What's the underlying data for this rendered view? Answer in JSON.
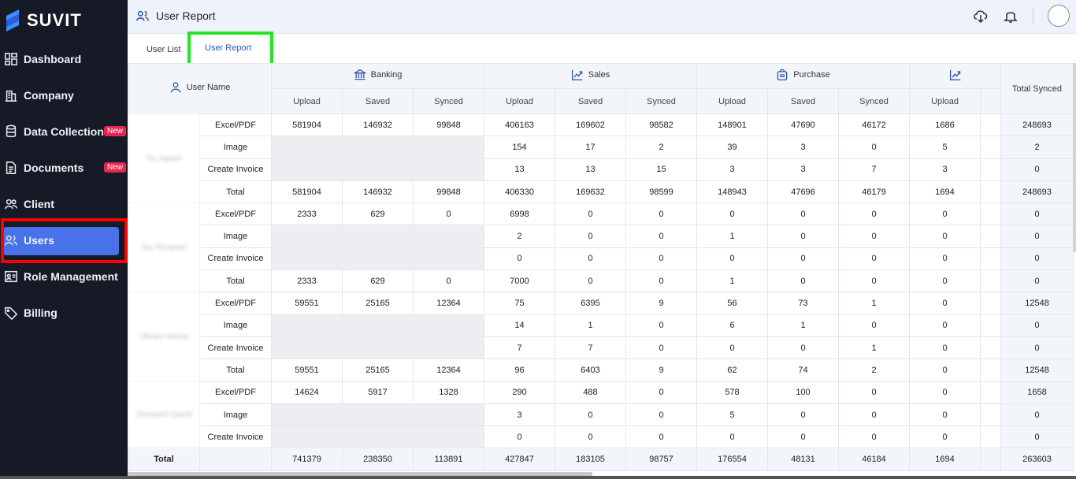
{
  "brand": {
    "name": "SUVIT"
  },
  "sidebar": {
    "items": [
      {
        "label": "Dashboard",
        "icon": "dashboard-icon"
      },
      {
        "label": "Company",
        "icon": "building-icon"
      },
      {
        "label": "Data Collection",
        "icon": "database-icon",
        "badge": "New"
      },
      {
        "label": "Documents",
        "icon": "document-icon",
        "badge": "New"
      },
      {
        "label": "Client",
        "icon": "client-icon"
      },
      {
        "label": "Users",
        "icon": "users-icon",
        "active": true
      },
      {
        "label": "Role Management",
        "icon": "role-icon"
      },
      {
        "label": "Billing",
        "icon": "tag-icon"
      }
    ]
  },
  "header": {
    "title": "User Report"
  },
  "tabs": {
    "user_list": "User List",
    "user_report": "User Report"
  },
  "table": {
    "user_name_header": "User Name",
    "groups": {
      "banking": "Banking",
      "sales": "Sales",
      "purchase": "Purchase",
      "total_synced": "Total Synced"
    },
    "sub": {
      "upload": "Upload",
      "saved": "Saved",
      "synced": "Synced"
    },
    "users": [
      {
        "name": "Xu Japani",
        "rows": [
          {
            "type": "Excel/PDF",
            "b": [
              "581904",
              "146932",
              "99848"
            ],
            "s": [
              "406163",
              "169602",
              "98582"
            ],
            "p": [
              "148901",
              "47690",
              "46172"
            ],
            "x": "1686",
            "t": "248693"
          },
          {
            "type": "Image",
            "s": [
              "154",
              "17",
              "2"
            ],
            "p": [
              "39",
              "3",
              "0"
            ],
            "x": "5",
            "t": "2"
          },
          {
            "type": "Create Invoice",
            "s": [
              "13",
              "13",
              "15"
            ],
            "p": [
              "3",
              "3",
              "7"
            ],
            "x": "3",
            "t": "0"
          },
          {
            "type": "Total",
            "b": [
              "581904",
              "146932",
              "99848"
            ],
            "s": [
              "406330",
              "169632",
              "98599"
            ],
            "p": [
              "148943",
              "47696",
              "46179"
            ],
            "x": "1694",
            "t": "248693"
          }
        ]
      },
      {
        "name": "Jay Rimarian",
        "rows": [
          {
            "type": "Excel/PDF",
            "b": [
              "2333",
              "629",
              "0"
            ],
            "s": [
              "6998",
              "0",
              "0"
            ],
            "p": [
              "0",
              "0",
              "0"
            ],
            "x": "0",
            "t": "0"
          },
          {
            "type": "Image",
            "s": [
              "2",
              "0",
              "0"
            ],
            "p": [
              "1",
              "0",
              "0"
            ],
            "x": "0",
            "t": "0"
          },
          {
            "type": "Create Invoice",
            "s": [
              "0",
              "0",
              "0"
            ],
            "p": [
              "0",
              "0",
              "0"
            ],
            "x": "0",
            "t": "0"
          },
          {
            "type": "Total",
            "b": [
              "2333",
              "629",
              "0"
            ],
            "s": [
              "7000",
              "0",
              "0"
            ],
            "p": [
              "1",
              "0",
              "0"
            ],
            "x": "0",
            "t": "0"
          }
        ]
      },
      {
        "name": "Vikram Varma",
        "rows": [
          {
            "type": "Excel/PDF",
            "b": [
              "59551",
              "25165",
              "12364"
            ],
            "s": [
              "75",
              "6395",
              "9"
            ],
            "p": [
              "56",
              "73",
              "1"
            ],
            "x": "0",
            "t": "12548"
          },
          {
            "type": "Image",
            "s": [
              "14",
              "1",
              "0"
            ],
            "p": [
              "6",
              "1",
              "0"
            ],
            "x": "0",
            "t": "0"
          },
          {
            "type": "Create Invoice",
            "s": [
              "7",
              "7",
              "0"
            ],
            "p": [
              "0",
              "0",
              "1"
            ],
            "x": "0",
            "t": "0"
          },
          {
            "type": "Total",
            "b": [
              "59551",
              "25165",
              "12364"
            ],
            "s": [
              "96",
              "6403",
              "9"
            ],
            "p": [
              "62",
              "74",
              "2"
            ],
            "x": "0",
            "t": "12548"
          }
        ]
      },
      {
        "name": "Shreyash Gandi",
        "rows": [
          {
            "type": "Excel/PDF",
            "b": [
              "14624",
              "5917",
              "1328"
            ],
            "s": [
              "290",
              "488",
              "0"
            ],
            "p": [
              "578",
              "100",
              "0"
            ],
            "x": "0",
            "t": "1658"
          },
          {
            "type": "Image",
            "s": [
              "3",
              "0",
              "0"
            ],
            "p": [
              "5",
              "0",
              "0"
            ],
            "x": "0",
            "t": "0"
          },
          {
            "type": "Create Invoice",
            "s": [
              "0",
              "0",
              "0"
            ],
            "p": [
              "0",
              "0",
              "0"
            ],
            "x": "0",
            "t": "0"
          }
        ]
      }
    ],
    "grand_total": {
      "label": "Total",
      "b": [
        "741379",
        "238350",
        "113891"
      ],
      "s": [
        "427847",
        "183105",
        "98757"
      ],
      "p": [
        "176554",
        "48131",
        "46184"
      ],
      "x": "1694",
      "t": "263603"
    }
  }
}
